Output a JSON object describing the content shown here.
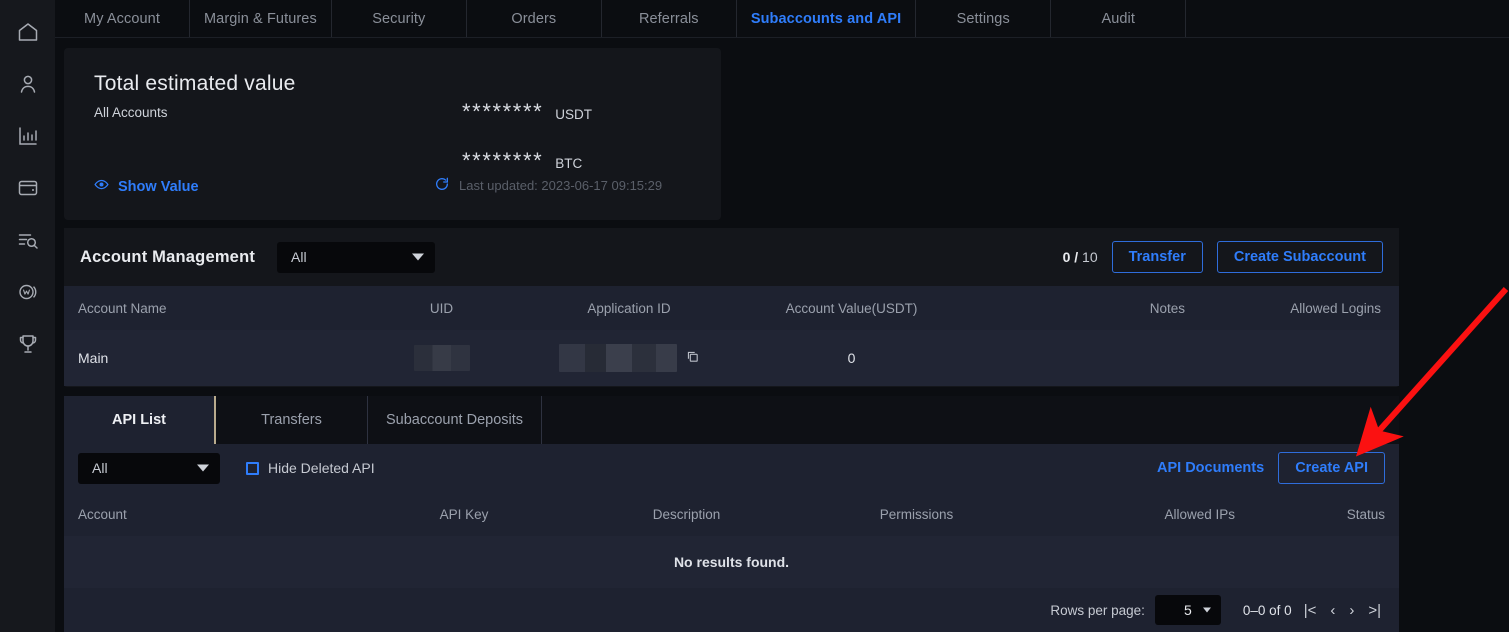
{
  "sidebar": {
    "items": [
      {
        "name": "home-icon",
        "label": "Home"
      },
      {
        "name": "user-icon",
        "label": "Account"
      },
      {
        "name": "bar-chart-icon",
        "label": "Markets"
      },
      {
        "name": "wallet-icon",
        "label": "Wallet"
      },
      {
        "name": "order-search-icon",
        "label": "Orders"
      },
      {
        "name": "w-coin-icon",
        "label": "Rewards"
      },
      {
        "name": "trophy-icon",
        "label": "Competition"
      }
    ]
  },
  "tabs": [
    {
      "label": "My Account",
      "active": false
    },
    {
      "label": "Margin & Futures",
      "active": false
    },
    {
      "label": "Security",
      "active": false
    },
    {
      "label": "Orders",
      "active": false
    },
    {
      "label": "Referrals",
      "active": false
    },
    {
      "label": "Subaccounts and API",
      "active": true
    },
    {
      "label": "Settings",
      "active": false
    },
    {
      "label": "Audit",
      "active": false
    }
  ],
  "total_value_card": {
    "title": "Total estimated value",
    "subtitle": "All Accounts",
    "show_value_label": "Show Value",
    "show_value_icon": "eye-icon",
    "refresh_icon": "refresh-icon",
    "last_updated": "Last updated: 2023-06-17 09:15:29",
    "amounts": [
      {
        "masked": "********",
        "unit": "USDT"
      },
      {
        "masked": "********",
        "unit": "BTC"
      }
    ]
  },
  "account_management": {
    "title": "Account Management",
    "filter_value": "All",
    "counter_current": "0",
    "counter_sep": "/",
    "counter_total": "10",
    "transfer_label": "Transfer",
    "create_subaccount_label": "Create Subaccount",
    "columns": [
      "Account Name",
      "UID",
      "Application ID",
      "Account Value(USDT)",
      "Notes",
      "Allowed Logins"
    ],
    "rows": [
      {
        "account_name": "Main",
        "uid": "",
        "application_id": "",
        "copy_icon": "copy-icon",
        "account_value": "0",
        "notes": "",
        "allowed_logins": ""
      }
    ]
  },
  "api_section": {
    "subtabs": [
      {
        "label": "API List",
        "active": true
      },
      {
        "label": "Transfers",
        "active": false
      },
      {
        "label": "Subaccount Deposits",
        "active": false
      }
    ],
    "filter_value": "All",
    "hide_deleted_label": "Hide Deleted API",
    "hide_deleted_checked": false,
    "api_documents_label": "API Documents",
    "create_api_label": "Create API",
    "columns": [
      "Account",
      "API Key",
      "Description",
      "Permissions",
      "Allowed IPs",
      "Status"
    ],
    "empty_message": "No results found.",
    "pagination": {
      "rows_per_page_label": "Rows per page:",
      "rows_per_page_value": "5",
      "range_label": "0–0 of 0",
      "first_icon": "|<",
      "prev_icon": "‹",
      "next_icon": "›",
      "last_icon": ">|"
    }
  },
  "annotation": {
    "arrow_color": "#fb1111",
    "points_to": "Create API"
  },
  "colors": {
    "accent_blue": "#2f7dfb",
    "panel_bg": "#14161b",
    "table_header_bg": "#1e2230",
    "table_row_bg": "#212534",
    "page_bg": "#0b0d11"
  }
}
